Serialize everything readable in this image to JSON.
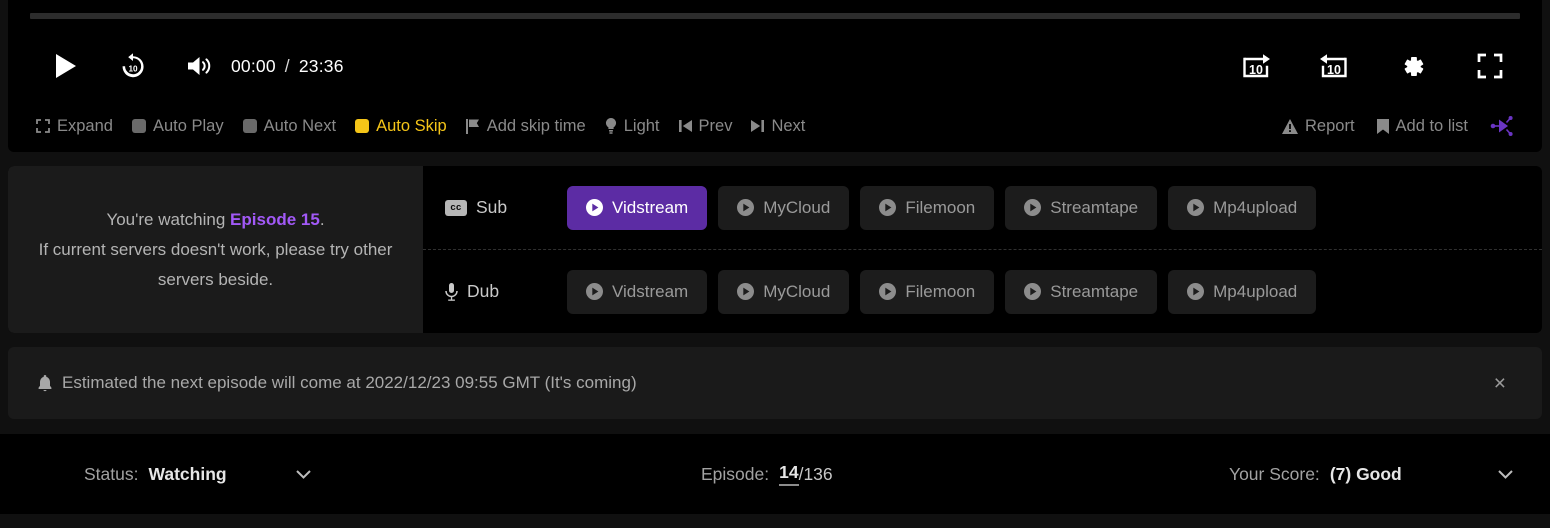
{
  "player": {
    "progress_percent": 0,
    "current_time": "00:00",
    "time_separator": "/",
    "duration": "23:36",
    "controls": {
      "play_label": "Play",
      "rewind10_label": "Rewind 10 seconds",
      "volume_label": "Volume",
      "skip_intro_label": "Skip forward 10",
      "skip_back_label": "Skip back 10",
      "settings_label": "Settings",
      "fullscreen_label": "Fullscreen"
    }
  },
  "options": {
    "left": [
      {
        "label": "Expand",
        "icon": "expand-icon",
        "type": "icon",
        "active": false
      },
      {
        "label": "Auto Play",
        "icon": "toggle-square-icon",
        "type": "toggle",
        "active": false
      },
      {
        "label": "Auto Next",
        "icon": "toggle-square-icon",
        "type": "toggle",
        "active": false
      },
      {
        "label": "Auto Skip",
        "icon": "toggle-square-icon",
        "type": "toggle",
        "active": true
      },
      {
        "label": "Add skip time",
        "icon": "flag-icon",
        "type": "icon",
        "active": false
      },
      {
        "label": "Light",
        "icon": "bulb-icon",
        "type": "icon",
        "active": false
      },
      {
        "label": "Prev",
        "icon": "prev-icon",
        "type": "icon",
        "active": false
      },
      {
        "label": "Next",
        "icon": "next-icon",
        "type": "icon",
        "active": false
      }
    ],
    "right": [
      {
        "label": "Report",
        "icon": "warning-icon"
      },
      {
        "label": "Add to list",
        "icon": "bookmark-icon"
      }
    ],
    "share_icon": "share-icon",
    "active_color": "#f5c518"
  },
  "servers": {
    "notice": {
      "line1_prefix": "You're watching ",
      "episode": "Episode 15",
      "line1_suffix": ".",
      "line2": "If current servers doesn't work, please try other servers beside.",
      "episode_color": "#a259f7"
    },
    "rows": [
      {
        "type": "Sub",
        "icon": "cc-icon",
        "cc_text": "cc",
        "servers": [
          {
            "name": "Vidstream",
            "active": true
          },
          {
            "name": "MyCloud",
            "active": false
          },
          {
            "name": "Filemoon",
            "active": false
          },
          {
            "name": "Streamtape",
            "active": false
          },
          {
            "name": "Mp4upload",
            "active": false
          }
        ]
      },
      {
        "type": "Dub",
        "icon": "microphone-icon",
        "servers": [
          {
            "name": "Vidstream",
            "active": false
          },
          {
            "name": "MyCloud",
            "active": false
          },
          {
            "name": "Filemoon",
            "active": false
          },
          {
            "name": "Streamtape",
            "active": false
          },
          {
            "name": "Mp4upload",
            "active": false
          }
        ]
      }
    ],
    "active_color": "#5c2ca4"
  },
  "notification": {
    "icon": "bell-icon",
    "text": "Estimated the next episode will come at 2022/12/23 09:55 GMT (It's coming)",
    "close_label": "×"
  },
  "statusbar": {
    "status": {
      "label": "Status:",
      "value": "Watching"
    },
    "episode": {
      "label": "Episode:",
      "current": "14",
      "separator": "/",
      "total": "136"
    },
    "score": {
      "label": "Your Score:",
      "value": "(7) Good"
    }
  }
}
